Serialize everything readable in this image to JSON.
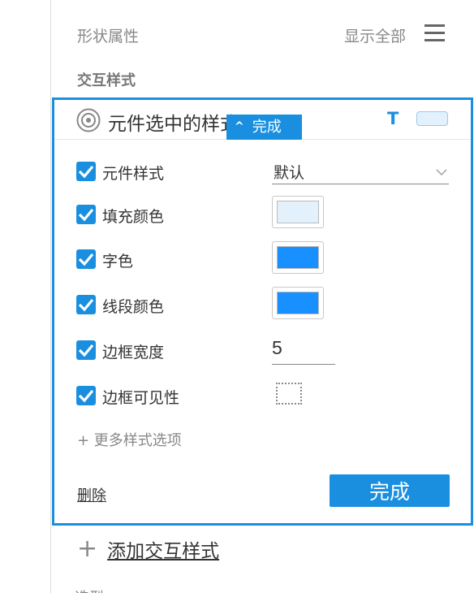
{
  "header": {
    "section_title": "形状属性",
    "show_all": "显示全部",
    "menu_icon": "hamburger-menu-icon"
  },
  "interaction_title": "交互样式",
  "panel": {
    "title": "元件选中的样式",
    "complete_tab_label": "完成",
    "text_style_icon": "T",
    "accent_color": "#1a8fe0",
    "properties": [
      {
        "label": "元件样式",
        "checked": true
      },
      {
        "label": "填充颜色",
        "checked": true
      },
      {
        "label": "字色",
        "checked": true
      },
      {
        "label": "线段颜色",
        "checked": true
      },
      {
        "label": "边框宽度",
        "checked": true
      },
      {
        "label": "边框可见性",
        "checked": true
      }
    ],
    "widget_style_value": "默认",
    "fill_color": "#e2f1fc",
    "font_color": "#1890ff",
    "line_color": "#1890ff",
    "border_width": "5",
    "more_options": "+ 更多样式选项",
    "delete_label": "删除",
    "done_label": "完成"
  },
  "add_interaction_style": "添加交互样式",
  "next_section_partial": "选型"
}
